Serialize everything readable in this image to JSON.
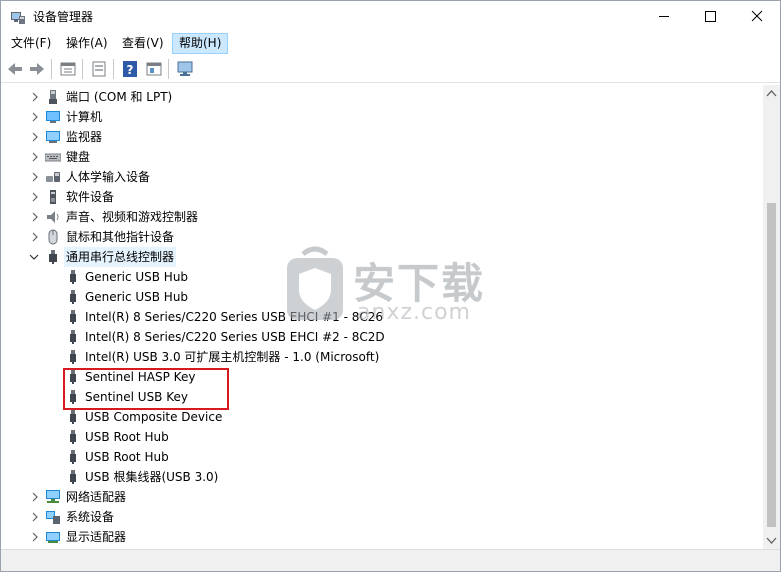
{
  "window": {
    "title": "设备管理器",
    "icon": "device-manager-icon"
  },
  "menu": [
    {
      "label": "文件(F)"
    },
    {
      "label": "操作(A)"
    },
    {
      "label": "查看(V)"
    },
    {
      "label": "帮助(H)",
      "active": true
    }
  ],
  "toolbar": {
    "buttons": [
      "back-arrow-icon",
      "forward-arrow-icon",
      "properties-icon",
      "show-hidden-icon",
      "help-icon",
      "update-driver-icon",
      "scan-hardware-icon"
    ]
  },
  "tree": {
    "categories_top": [
      {
        "label": "端口 (COM 和 LPT)",
        "icon": "port-icon"
      },
      {
        "label": "计算机",
        "icon": "computer-icon"
      },
      {
        "label": "监视器",
        "icon": "monitor-icon"
      },
      {
        "label": "键盘",
        "icon": "keyboard-icon"
      },
      {
        "label": "人体学输入设备",
        "icon": "hid-icon"
      },
      {
        "label": "软件设备",
        "icon": "software-device-icon"
      },
      {
        "label": "声音、视频和游戏控制器",
        "icon": "sound-icon"
      },
      {
        "label": "鼠标和其他指针设备",
        "icon": "mouse-icon"
      }
    ],
    "usb_category": {
      "label": "通用串行总线控制器",
      "icon": "usb-icon",
      "expanded": true
    },
    "usb_children": [
      {
        "label": "Generic USB Hub"
      },
      {
        "label": "Generic USB Hub"
      },
      {
        "label": "Intel(R) 8 Series/C220 Series USB EHCI #1 - 8C26"
      },
      {
        "label": "Intel(R) 8 Series/C220 Series USB EHCI #2 - 8C2D"
      },
      {
        "label": "Intel(R) USB 3.0 可扩展主机控制器 - 1.0 (Microsoft)"
      },
      {
        "label": "Sentinel HASP Key"
      },
      {
        "label": "Sentinel USB Key"
      },
      {
        "label": "USB Composite Device"
      },
      {
        "label": "USB Root Hub"
      },
      {
        "label": "USB Root Hub"
      },
      {
        "label": "USB 根集线器(USB 3.0)"
      }
    ],
    "categories_bottom": [
      {
        "label": "网络适配器",
        "icon": "network-adapter-icon"
      },
      {
        "label": "系统设备",
        "icon": "system-device-icon"
      },
      {
        "label": "显示适配器",
        "icon": "display-adapter-icon"
      }
    ]
  },
  "watermark": {
    "text": "安下载",
    "sub": "anxz.com"
  },
  "colors": {
    "highlight": "#d71920",
    "selection": "#e5f3ff",
    "menu_active": "#cce8ff"
  }
}
